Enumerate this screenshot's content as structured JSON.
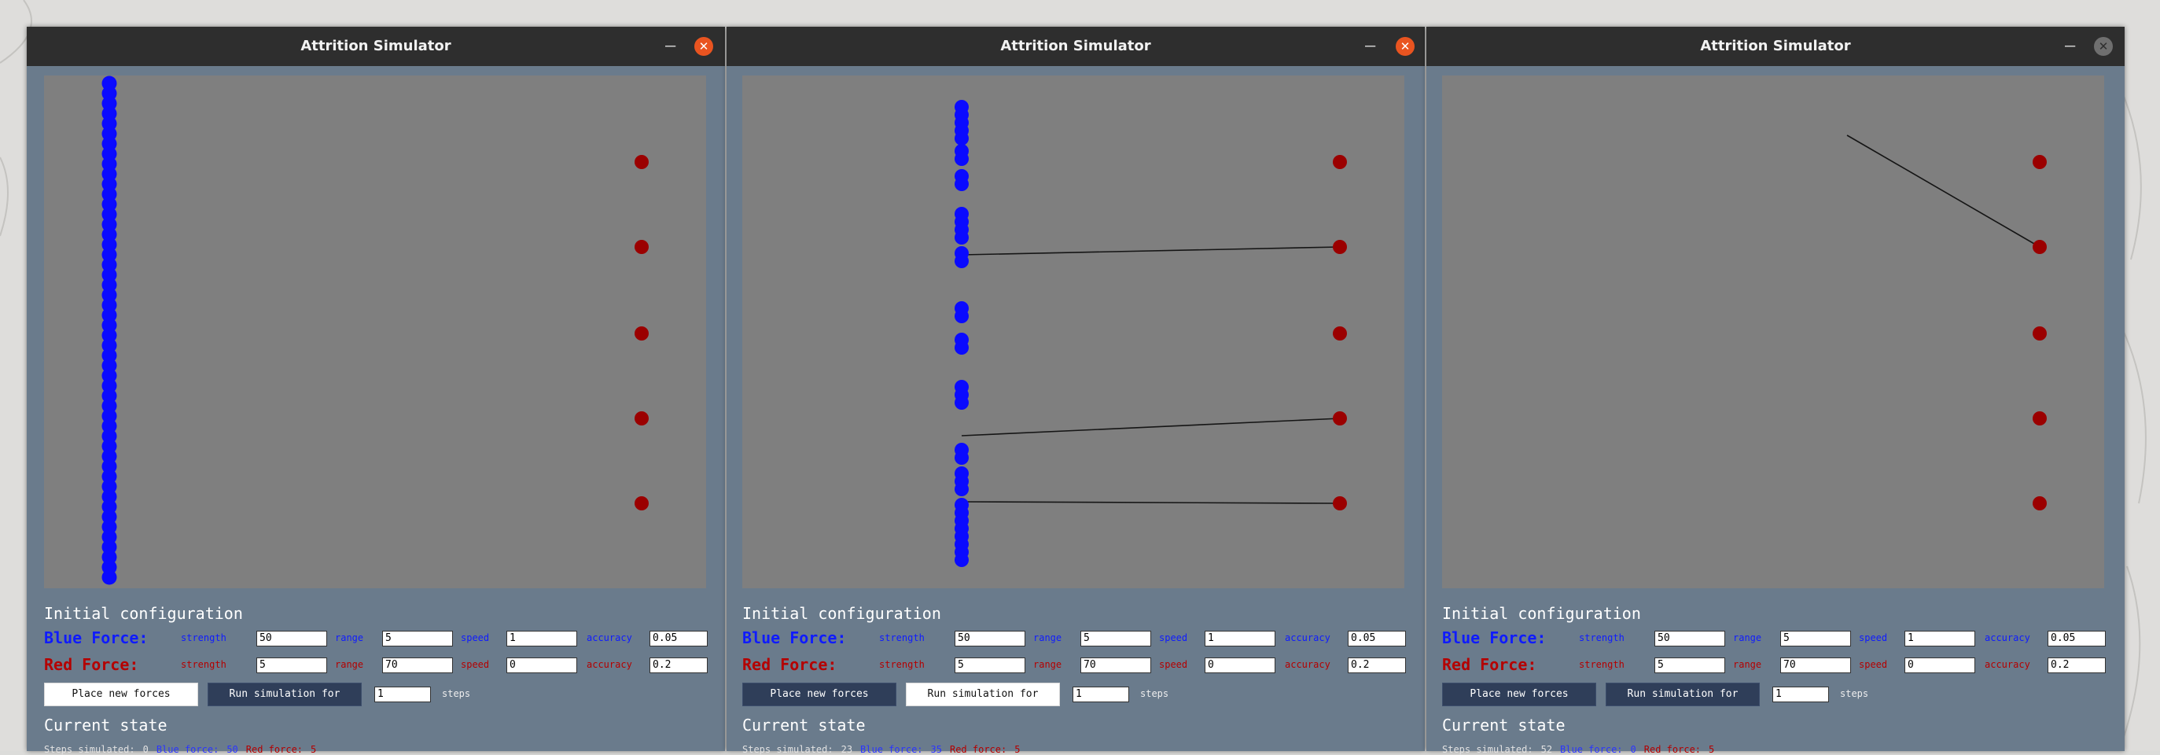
{
  "colors": {
    "blue_unit": "#0a0aff",
    "red_unit": "#9b0000",
    "canvas": "#7f7f7f",
    "window_body": "#6a7b8c",
    "titlebar": "#2e2e2e",
    "close_active": "#e95420"
  },
  "windows": [
    {
      "title": "Attrition Simulator",
      "minimize_icon": "–",
      "close_icon": "✕",
      "close_state": "active",
      "config_heading": "Initial configuration",
      "blue_force_label": "Blue Force:",
      "red_force_label": "Red Force:",
      "labels": {
        "strength": "strength",
        "range": "range",
        "speed": "speed",
        "accuracy": "accuracy"
      },
      "blue": {
        "strength": "50",
        "range": "5",
        "speed": "1",
        "accuracy": "0.05"
      },
      "red": {
        "strength": "5",
        "range": "70",
        "speed": "0",
        "accuracy": "0.2"
      },
      "place_button": "Place new forces",
      "run_button": "Run simulation for",
      "steps_value": "1",
      "steps_label": "steps",
      "place_style": "light",
      "run_style": "dark",
      "state_heading": "Current state",
      "steps_simulated_label": "Steps simulated:",
      "steps_simulated": "0",
      "blue_force_status_label": "Blue force:",
      "blue_force_count": "50",
      "red_force_status_label": "Red force:",
      "red_force_count": "5"
    },
    {
      "title": "Attrition Simulator",
      "minimize_icon": "–",
      "close_icon": "✕",
      "close_state": "active",
      "config_heading": "Initial configuration",
      "blue_force_label": "Blue Force:",
      "red_force_label": "Red Force:",
      "labels": {
        "strength": "strength",
        "range": "range",
        "speed": "speed",
        "accuracy": "accuracy"
      },
      "blue": {
        "strength": "50",
        "range": "5",
        "speed": "1",
        "accuracy": "0.05"
      },
      "red": {
        "strength": "5",
        "range": "70",
        "speed": "0",
        "accuracy": "0.2"
      },
      "place_button": "Place new forces",
      "run_button": "Run simulation for",
      "steps_value": "1",
      "steps_label": "steps",
      "place_style": "dark",
      "run_style": "light",
      "state_heading": "Current state",
      "steps_simulated_label": "Steps simulated:",
      "steps_simulated": "23",
      "blue_force_status_label": "Blue force:",
      "blue_force_count": "35",
      "red_force_status_label": "Red force:",
      "red_force_count": "5"
    },
    {
      "title": "Attrition Simulator",
      "minimize_icon": "–",
      "close_icon": "✕",
      "close_state": "inactive",
      "config_heading": "Initial configuration",
      "blue_force_label": "Blue Force:",
      "red_force_label": "Red Force:",
      "labels": {
        "strength": "strength",
        "range": "range",
        "speed": "speed",
        "accuracy": "accuracy"
      },
      "blue": {
        "strength": "50",
        "range": "5",
        "speed": "1",
        "accuracy": "0.05"
      },
      "red": {
        "strength": "5",
        "range": "70",
        "speed": "0",
        "accuracy": "0.2"
      },
      "place_button": "Place new forces",
      "run_button": "Run simulation for",
      "steps_value": "1",
      "steps_label": "steps",
      "place_style": "dark",
      "run_style": "dark",
      "state_heading": "Current state",
      "steps_simulated_label": "Steps simulated:",
      "steps_simulated": "52",
      "blue_force_status_label": "Blue force:",
      "blue_force_count": "0",
      "red_force_status_label": "Red force:",
      "red_force_count": "5"
    }
  ]
}
